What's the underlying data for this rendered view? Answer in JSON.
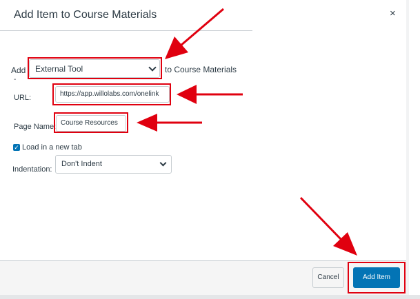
{
  "dialog": {
    "title": "Add Item to Course Materials",
    "close_glyph": "×"
  },
  "add_row": {
    "prefix": "Add",
    "type_value": "External Tool",
    "suffix": "to Course Materials",
    "dash": "-"
  },
  "fields": {
    "url_label": "URL:",
    "url_value": "https://app.willolabs.com/onelink",
    "page_name_label": "Page Name:",
    "page_name_value": "Course Resources",
    "new_tab_label": "Load in a new tab",
    "new_tab_checked": true,
    "indentation_label": "Indentation:",
    "indentation_value": "Don't Indent"
  },
  "footer": {
    "cancel_label": "Cancel",
    "add_label": "Add Item"
  },
  "colors": {
    "accent": "#0374b5",
    "annotation_red": "#e0000f"
  },
  "icons": {
    "close": "close-icon",
    "chevron": "chevron-down-icon",
    "check": "checkmark-icon",
    "annotation": "red-arrow"
  }
}
